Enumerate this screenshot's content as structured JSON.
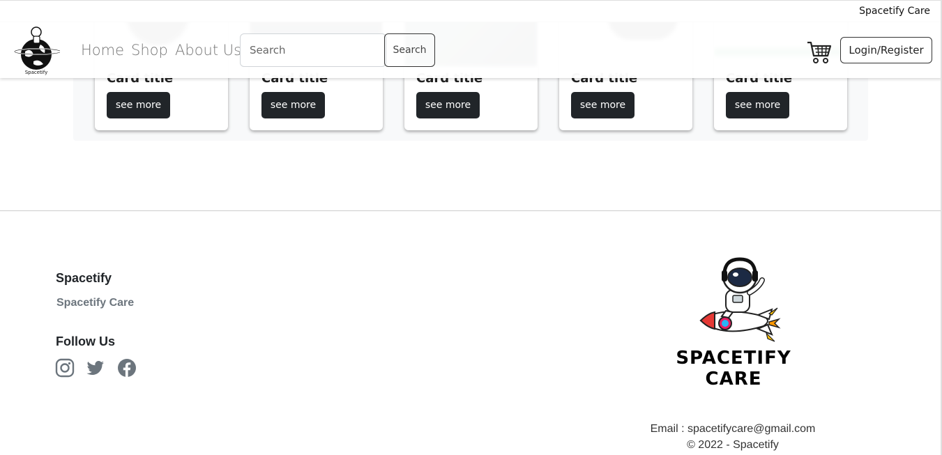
{
  "top_strip": {
    "brand": "Spacetify Care"
  },
  "cards": [
    {
      "title": "Card title",
      "button": "see more",
      "image_colors": [
        "#e9ecef",
        "#1a1a1a"
      ]
    },
    {
      "title": "Card title",
      "button": "see more",
      "image_colors": [
        "#2a2d33",
        "#0f1012"
      ]
    },
    {
      "title": "Card title",
      "button": "see more",
      "image_colors": [
        "#3a4a5a",
        "#1c2630"
      ]
    },
    {
      "title": "Card title",
      "button": "see more",
      "image_colors": [
        "#f4f4f4",
        "#111111"
      ]
    },
    {
      "title": "Card title",
      "button": "see more",
      "image_colors": [
        "#f2f2f2",
        "#2aa05a"
      ]
    }
  ],
  "navbar": {
    "logo_alt": "Spacetify",
    "links": [
      "Home",
      "Shop",
      "About Us"
    ],
    "search": {
      "placeholder": "Search",
      "value": "",
      "button": "Search"
    },
    "cart_icon": "shopping-cart-icon",
    "login_button": "Login/Register"
  },
  "footer": {
    "brand_title": "Spacetify",
    "brand_sub": "Spacetify Care",
    "follow_title": "Follow Us",
    "social_icons": [
      "instagram-icon",
      "twitter-icon",
      "facebook-icon"
    ],
    "logo_text": "SPACETIFY CARE",
    "email": "Email : spacetifycare@gmail.com",
    "copyright": "© 2022 - Spacetify"
  },
  "colors": {
    "button_dark": "#212529",
    "muted": "#6c757d",
    "icon_gray": "#6c757d"
  }
}
